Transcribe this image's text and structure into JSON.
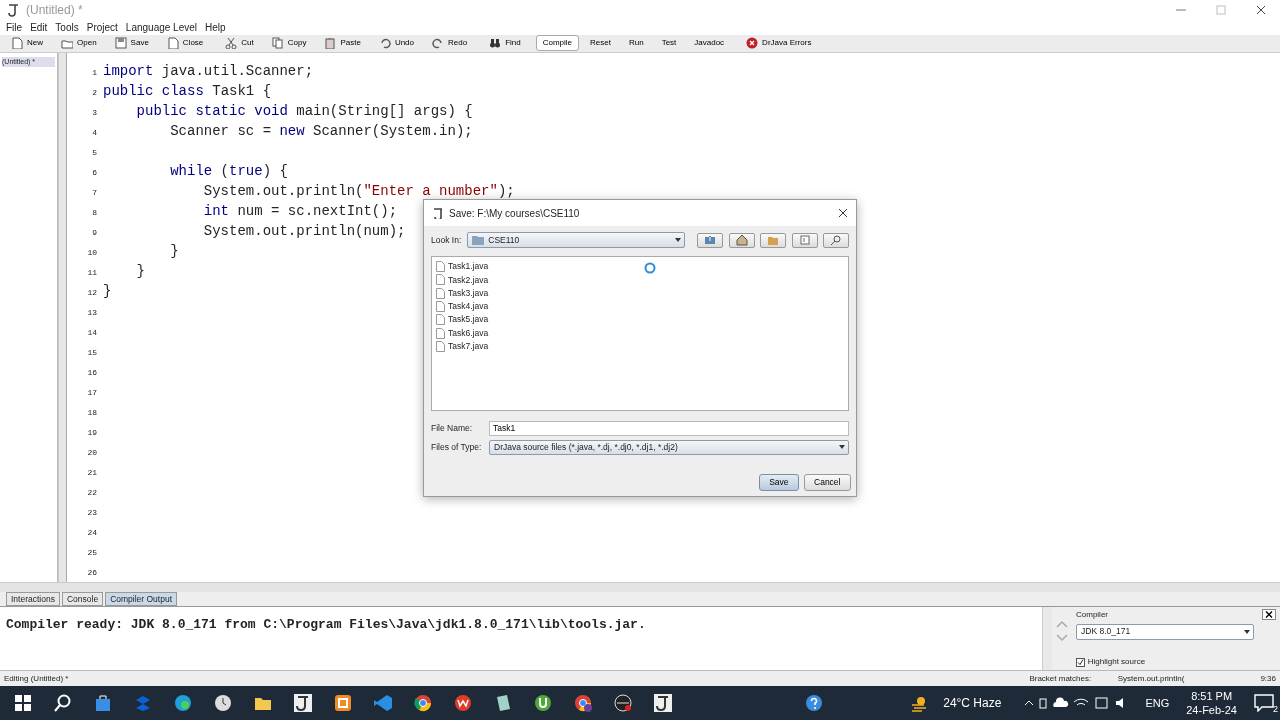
{
  "window": {
    "title": "(Untitled) *"
  },
  "menu": [
    "File",
    "Edit",
    "Tools",
    "Project",
    "Language Level",
    "Help"
  ],
  "toolbar": [
    {
      "label": "New"
    },
    {
      "label": "Open"
    },
    {
      "label": "Save"
    },
    {
      "label": "Close"
    },
    {
      "label": "Cut"
    },
    {
      "label": "Copy"
    },
    {
      "label": "Paste"
    },
    {
      "label": "Undo"
    },
    {
      "label": "Redo"
    },
    {
      "label": "Find"
    },
    {
      "label": "Compile",
      "selected": true
    },
    {
      "label": "Reset",
      "selected": false
    },
    {
      "label": "Run",
      "selected": false
    },
    {
      "label": "Test",
      "selected": false
    },
    {
      "label": "Javadoc",
      "selected": false
    },
    {
      "label": "DrJava Errors"
    }
  ],
  "documents": [
    {
      "label": "(Untitled) *",
      "selected": true
    }
  ],
  "code_lines": [
    {
      "number": "1",
      "parts": [
        {
          "t": "import",
          "kind": "keyword"
        },
        {
          "t": " java.util.Scanner;",
          "kind": "plain"
        }
      ]
    },
    {
      "number": "2",
      "parts": [
        {
          "t": "public class",
          "kind": "keyword"
        },
        {
          "t": " Task1 {",
          "kind": "plain"
        }
      ]
    },
    {
      "number": "3",
      "parts": [
        {
          "t": "    public static void",
          "kind": "keyword"
        },
        {
          "t": " main(String[] args) {",
          "kind": "plain"
        }
      ]
    },
    {
      "number": "4",
      "parts": [
        {
          "t": "        Scanner sc = ",
          "kind": "plain"
        },
        {
          "t": "new",
          "kind": "keyword"
        },
        {
          "t": " Scanner(System.in);",
          "kind": "plain"
        }
      ]
    },
    {
      "number": "5"
    },
    {
      "number": "6",
      "parts": [
        {
          "t": "        while",
          "kind": "keyword"
        },
        {
          "t": " (",
          "kind": "plain"
        },
        {
          "t": "true",
          "kind": "keyword"
        },
        {
          "t": ") {",
          "kind": "plain"
        }
      ]
    },
    {
      "number": "7",
      "parts": [
        {
          "t": "            System.out.println(",
          "kind": "plain"
        },
        {
          "t": "\"Enter a number\"",
          "kind": "string"
        },
        {
          "t": ");",
          "kind": "plain"
        }
      ]
    },
    {
      "number": "8",
      "parts": [
        {
          "t": "            int",
          "kind": "keyword"
        },
        {
          "t": " num = sc.nextInt();",
          "kind": "plain"
        }
      ]
    },
    {
      "number": "9",
      "parts": [
        {
          "t": "            System.out.println(num);",
          "kind": "plain"
        }
      ]
    },
    {
      "number": "10",
      "parts": [
        {
          "t": "        }",
          "kind": "plain"
        }
      ]
    },
    {
      "number": "11",
      "parts": [
        {
          "t": "    }",
          "kind": "plain"
        }
      ]
    },
    {
      "number": "12",
      "parts": [
        {
          "t": "}",
          "kind": "plain"
        }
      ]
    },
    {
      "number": "13"
    },
    {
      "number": "14"
    },
    {
      "number": "15"
    },
    {
      "number": "16"
    },
    {
      "number": "17"
    },
    {
      "number": "18"
    },
    {
      "number": "19"
    },
    {
      "number": "20"
    },
    {
      "number": "21"
    },
    {
      "number": "22"
    },
    {
      "number": "23"
    },
    {
      "number": "24"
    },
    {
      "number": "25"
    },
    {
      "number": "26"
    }
  ],
  "bottom_tabs": [
    {
      "label": "Interactions",
      "selected": false
    },
    {
      "label": "Console",
      "selected": false
    },
    {
      "label": "Compiler Output",
      "selected": true
    }
  ],
  "output": "Compiler ready: JDK 8.0_171 from C:\\Program Files\\Java\\jdk1.8.0_171\\lib\\tools.jar.",
  "compiler": {
    "label": "Compiler",
    "value": "JDK 8.0_171",
    "highlight_label": "Highlight source",
    "highlight_checked": true
  },
  "status_bar": {
    "left": "Editing (Untitled) *",
    "bracket_label": "Bracket matches:",
    "bracket_value": "System.out.println(",
    "position": "9:36"
  },
  "dialog": {
    "title": "Save:  F:\\My courses\\CSE110",
    "look_in_label": "Look In:",
    "look_in_value": "CSE110",
    "files": [
      "Task1.java",
      "Task2.java",
      "Task3.java",
      "Task4.java",
      "Task5.java",
      "Task6.java",
      "Task7.java"
    ],
    "file_name_label": "File Name:",
    "file_name": "Task1",
    "type_label": "Files of Type:",
    "type_value": "DrJava source files (*.java, *.dj, *.dj0, *.dj1, *.dj2)",
    "buttons": [
      {
        "label": "Save",
        "primary": true
      },
      {
        "label": "Cancel",
        "primary": false
      }
    ]
  },
  "taskbar": {
    "weather": "24°C  Haze",
    "language": "ENG",
    "time": "8:51 PM",
    "date": "24-Feb-24",
    "notifications": "2"
  }
}
